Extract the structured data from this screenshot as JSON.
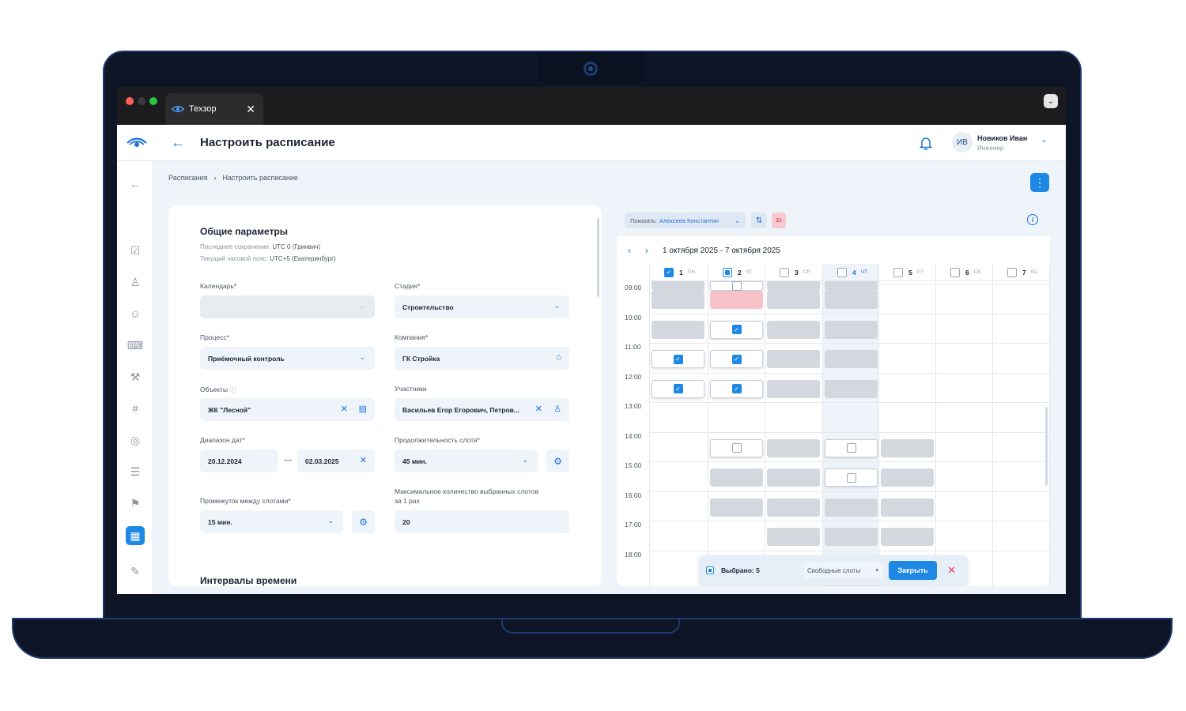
{
  "browser": {
    "tab_title": "Техзор",
    "tab_close": "✕",
    "menu_icon": "chevron-down-icon"
  },
  "header": {
    "back_arrow": "←",
    "title": "Настроить расписание",
    "user": {
      "initials": "ИВ",
      "name": "Новиков Иван",
      "role": "Инженер"
    }
  },
  "sidebar": {
    "items": [
      "back-arrow-icon",
      "task-check-icon",
      "user-icon",
      "users-icon",
      "paint-roller-icon",
      "wrench-icon",
      "hash-icon",
      "target-check-icon",
      "list-icon",
      "flag-icon",
      "calendar-icon",
      "edit-doc-icon"
    ],
    "active": "calendar-icon"
  },
  "breadcrumb": {
    "items": [
      "Расписания",
      "Настроить расписание"
    ],
    "separator": "›"
  },
  "form": {
    "section_title": "Общие параметры",
    "last_saved_label": "Последнее сохранение:",
    "last_saved_value": "UTC 0 (Гринвич)",
    "timezone_label": "Текущий часовой пояс:",
    "timezone_value": "UTC+5 (Екатеринбург)",
    "calendar": {
      "label": "Календарь*",
      "value": ""
    },
    "stage": {
      "label": "Стадия*",
      "value": "Строительство"
    },
    "process": {
      "label": "Процесс*",
      "value": "Приёмочный контроль"
    },
    "company": {
      "label": "Компания*",
      "value": "ГК Стройка"
    },
    "objects": {
      "label": "Объекты",
      "value": "ЖК \"Лесной\""
    },
    "participants": {
      "label": "Участники",
      "value": "Васильев Егор Егорович, Петров..."
    },
    "date_range": {
      "label": "Диапазон дат*",
      "from": "20.12.2024",
      "separator": "—",
      "to": "02.03.2025"
    },
    "slot_duration": {
      "label": "Продолжительность слота*",
      "value": "45 мин."
    },
    "slot_gap": {
      "label": "Промежуток между слотами*",
      "value": "15 мин."
    },
    "max_slots": {
      "label_line1": "Максимальное количество выбранных слотов",
      "label_line2": "за 1 раз",
      "value": "20"
    },
    "next_section_title": "Интервалы времени"
  },
  "calendar": {
    "show_label": "Показать:",
    "show_value": "Алексеев Константин",
    "badge": "31",
    "week_range": "1 октября 2025 - 7 октября 2025",
    "days": [
      {
        "num": "1",
        "name": "ПН",
        "state": "checked"
      },
      {
        "num": "2",
        "name": "ВТ",
        "state": "partial"
      },
      {
        "num": "3",
        "name": "СР",
        "state": "off"
      },
      {
        "num": "4",
        "name": "ЧТ",
        "state": "off",
        "active": true
      },
      {
        "num": "5",
        "name": "ПТ",
        "state": "off"
      },
      {
        "num": "6",
        "name": "СБ",
        "state": "off"
      },
      {
        "num": "7",
        "name": "ВС",
        "state": "off"
      }
    ],
    "times": [
      "09:00",
      "10:00",
      "11:00",
      "12:00",
      "13:00",
      "14:00",
      "15:00",
      "16:00",
      "17:00",
      "18:00"
    ],
    "slots": [
      {
        "day": 1,
        "row": 0,
        "kind": "avail"
      },
      {
        "day": 2,
        "row": 0,
        "kind": "off"
      },
      {
        "day": 3,
        "row": 0,
        "kind": "avail"
      },
      {
        "day": 4,
        "row": 0,
        "kind": "avail"
      },
      {
        "day": 1,
        "row": 1,
        "kind": "avail"
      },
      {
        "day": 2,
        "row": 1,
        "kind": "busy"
      },
      {
        "day": 3,
        "row": 1,
        "kind": "avail"
      },
      {
        "day": 4,
        "row": 1,
        "kind": "avail"
      },
      {
        "day": 1,
        "row": 2,
        "kind": "avail"
      },
      {
        "day": 2,
        "row": 2,
        "kind": "checked"
      },
      {
        "day": 3,
        "row": 2,
        "kind": "avail"
      },
      {
        "day": 4,
        "row": 2,
        "kind": "avail"
      },
      {
        "day": 1,
        "row": 3,
        "kind": "checked"
      },
      {
        "day": 2,
        "row": 3,
        "kind": "checked"
      },
      {
        "day": 3,
        "row": 3,
        "kind": "avail"
      },
      {
        "day": 4,
        "row": 3,
        "kind": "avail"
      },
      {
        "day": 1,
        "row": 4,
        "kind": "checked"
      },
      {
        "day": 2,
        "row": 4,
        "kind": "checked"
      },
      {
        "day": 3,
        "row": 4,
        "kind": "avail"
      },
      {
        "day": 4,
        "row": 4,
        "kind": "avail"
      },
      {
        "day": 2,
        "row": 6,
        "kind": "off"
      },
      {
        "day": 3,
        "row": 6,
        "kind": "avail"
      },
      {
        "day": 4,
        "row": 6,
        "kind": "off"
      },
      {
        "day": 5,
        "row": 6,
        "kind": "avail"
      },
      {
        "day": 2,
        "row": 7,
        "kind": "avail"
      },
      {
        "day": 3,
        "row": 7,
        "kind": "avail"
      },
      {
        "day": 4,
        "row": 7,
        "kind": "off"
      },
      {
        "day": 5,
        "row": 7,
        "kind": "avail"
      },
      {
        "day": 2,
        "row": 8,
        "kind": "avail"
      },
      {
        "day": 3,
        "row": 8,
        "kind": "avail"
      },
      {
        "day": 4,
        "row": 8,
        "kind": "avail"
      },
      {
        "day": 5,
        "row": 8,
        "kind": "avail"
      },
      {
        "day": 3,
        "row": 9,
        "kind": "avail"
      },
      {
        "day": 4,
        "row": 9,
        "kind": "avail"
      },
      {
        "day": 5,
        "row": 9,
        "kind": "avail"
      }
    ],
    "selection": {
      "count_label": "Выбрано: 5",
      "filter_value": "Свободные слоты",
      "close_label": "Закрыть"
    }
  },
  "colors": {
    "accent": "#1e88e5",
    "busy": "#f8c3c8",
    "available": "#d3d8de",
    "danger": "#e53950"
  }
}
